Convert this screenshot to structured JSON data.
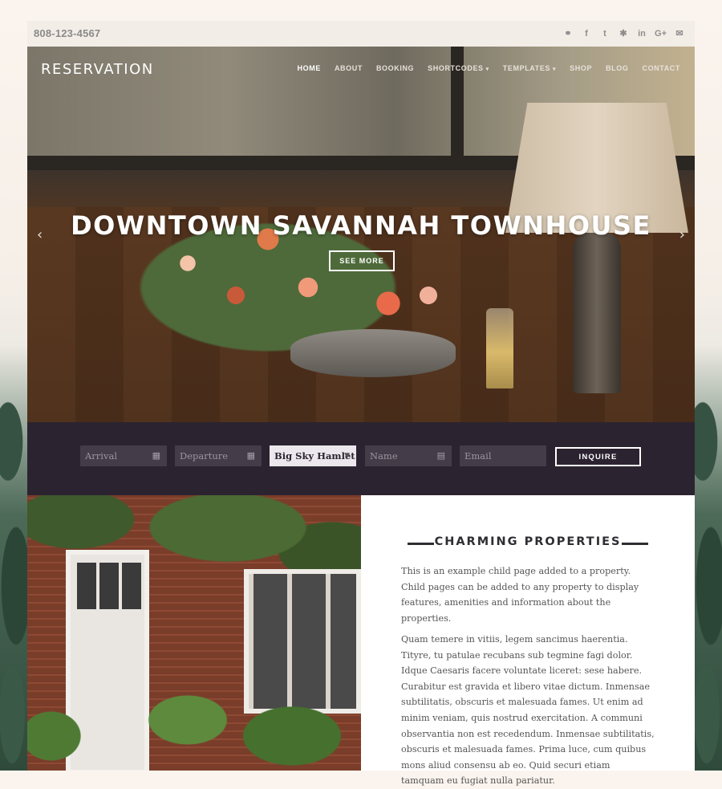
{
  "topbar": {
    "phone": "808-123-4567",
    "social_icons": [
      "link-icon",
      "facebook-icon",
      "twitter-icon",
      "yelp-icon",
      "linkedin-icon",
      "google-plus-icon",
      "email-icon"
    ],
    "social_glyphs": [
      "⚭",
      "f",
      "t",
      "✱",
      "in",
      "G+",
      "✉"
    ]
  },
  "header": {
    "brand": "RESERVATION",
    "nav": [
      {
        "label": "HOME",
        "active": true
      },
      {
        "label": "ABOUT"
      },
      {
        "label": "BOOKING"
      },
      {
        "label": "SHORTCODES",
        "dropdown": true
      },
      {
        "label": "TEMPLATES",
        "dropdown": true
      },
      {
        "label": "SHOP"
      },
      {
        "label": "BLOG"
      },
      {
        "label": "CONTACT"
      }
    ]
  },
  "hero": {
    "title": "DOWNTOWN SAVANNAH TOWNHOUSE",
    "cta": "SEE MORE",
    "prev_arrow": "‹",
    "next_arrow": "›"
  },
  "booking": {
    "arrival_placeholder": "Arrival",
    "departure_placeholder": "Departure",
    "property_selected": "Big Sky Hamlet",
    "name_placeholder": "Name",
    "email_placeholder": "Email",
    "submit": "INQUIRE"
  },
  "section": {
    "title": "CHARMING PROPERTIES",
    "paragraph1": "This is an example child page added to a property. Child pages can be added to any property to display features, amenities and information about the properties.",
    "paragraph2": "Quam temere in vitiis, legem sancimus haerentia. Tityre, tu patulae recubans sub tegmine fagi  dolor. Idque Caesaris facere voluntate liceret: sese habere. Curabitur est gravida et libero vitae dictum. Inmensae subtilitatis, obscuris et malesuada fames. Ut enim ad minim veniam, quis nostrud exercitation. A communi observantia non est recedendum. Inmensae subtilitatis, obscuris et malesuada fames. Prima luce, cum quibus mons aliud  consensu ab eo. Quid securi etiam tamquam eu fugiat nulla pariatur."
  }
}
